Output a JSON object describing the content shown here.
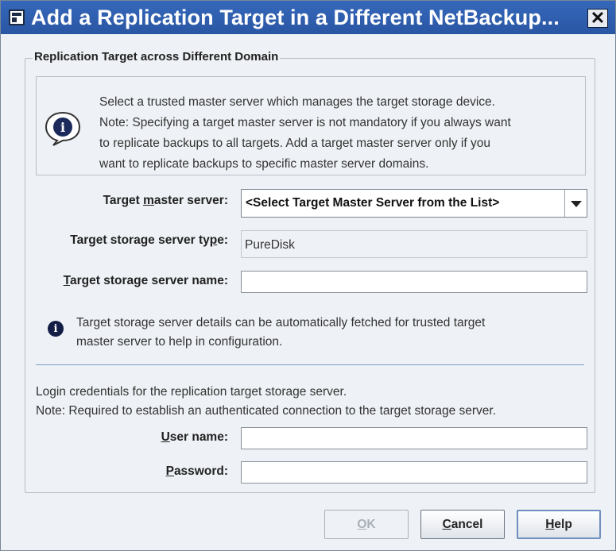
{
  "window": {
    "title": "Add a Replication Target in a Different NetBackup...",
    "close_glyph": "✕",
    "icon": "app-window-icon"
  },
  "group": {
    "legend": "Replication Target across Different Domain"
  },
  "note": {
    "icon": "info-speech-bubble-icon",
    "lines": [
      "Select a trusted master server which manages the target storage device.",
      "Note: Specifying a target master server is not mandatory if you always want",
      "to replicate backups to all targets. Add a target master server only if you",
      "want to replicate backups to specific master server domains."
    ]
  },
  "fields": {
    "master_server": {
      "label_pre": "Target ",
      "label_mnemonic": "m",
      "label_post": "aster server:",
      "value": "<Select Target Master Server from the List>"
    },
    "server_type": {
      "label_pre": "Target storage server ty",
      "label_mnemonic": "p",
      "label_post": "e:",
      "value": "PureDisk"
    },
    "server_name": {
      "label_mnemonic": "T",
      "label_post": "arget storage server name:",
      "value": ""
    }
  },
  "hint": {
    "icon": "info-icon",
    "glyph": "i",
    "lines": [
      "Target storage server details can be automatically fetched for trusted target",
      "master server to help in configuration."
    ]
  },
  "credentials": {
    "lines": [
      "Login credentials for the replication target storage server.",
      "Note: Required to establish an authenticated connection to the target storage server."
    ],
    "user": {
      "label_mnemonic": "U",
      "label_post": "ser name:",
      "value": ""
    },
    "password": {
      "label_mnemonic": "P",
      "label_post": "assword:",
      "value": ""
    }
  },
  "buttons": {
    "ok": {
      "mnemonic": "O",
      "rest": "K",
      "enabled": false
    },
    "cancel": {
      "mnemonic": "C",
      "rest": "ancel"
    },
    "help": {
      "mnemonic": "H",
      "rest": "elp"
    }
  },
  "colors": {
    "titlebar": "#2d5fb0",
    "background": "#eef1f5",
    "separator": "#7d9fcc",
    "info_icon": "#121e46"
  }
}
